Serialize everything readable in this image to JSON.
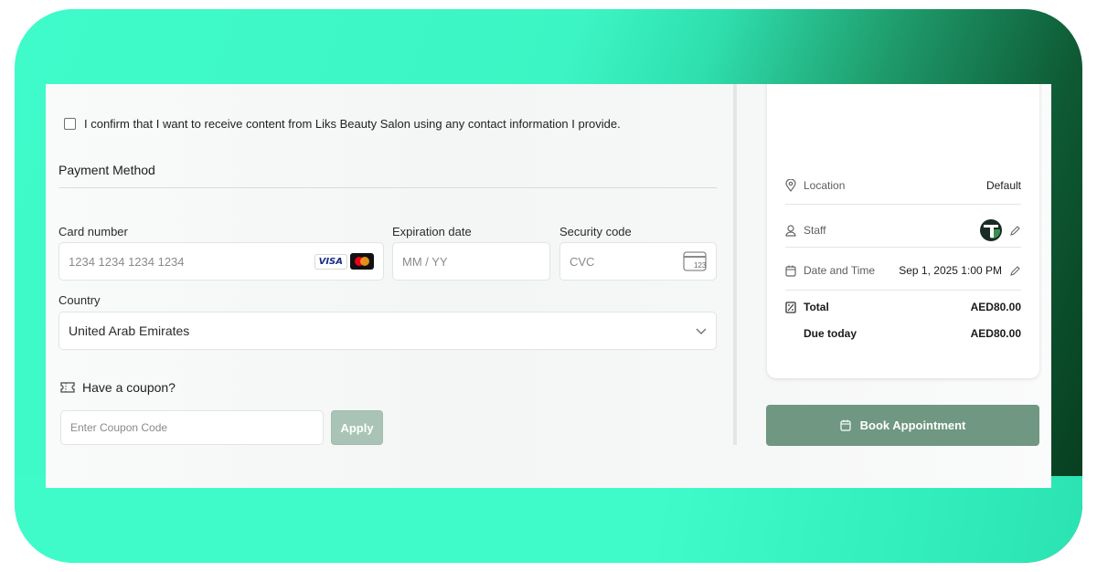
{
  "consent": {
    "text": "I confirm that I want to receive content from Liks Beauty Salon using any contact information I provide.",
    "checked": false
  },
  "payment": {
    "title": "Payment Method",
    "card_number_label": "Card number",
    "card_number_placeholder": "1234 1234 1234 1234",
    "card_brands": [
      "VISA",
      "mastercard"
    ],
    "expiration_label": "Expiration date",
    "expiration_placeholder": "MM / YY",
    "security_label": "Security code",
    "security_placeholder": "CVC",
    "cvc_icon_text": "123",
    "country_label": "Country",
    "country_value": "United Arab Emirates"
  },
  "coupon": {
    "title": "Have a coupon?",
    "placeholder": "Enter Coupon Code",
    "apply_label": "Apply"
  },
  "summary": {
    "location_label": "Location",
    "location_value": "Default",
    "staff_label": "Staff",
    "datetime_label": "Date and Time",
    "datetime_value": "Sep 1, 2025 1:00 PM",
    "total_label": "Total",
    "total_value": "AED80.00",
    "due_label": "Due today",
    "due_value": "AED80.00"
  },
  "book_button_label": "Book Appointment",
  "colors": {
    "frame_mint": "#3ffbca",
    "frame_dark_green": "#063a1c",
    "book_button": "#6f9781",
    "apply_button": "#a9c4b6"
  }
}
